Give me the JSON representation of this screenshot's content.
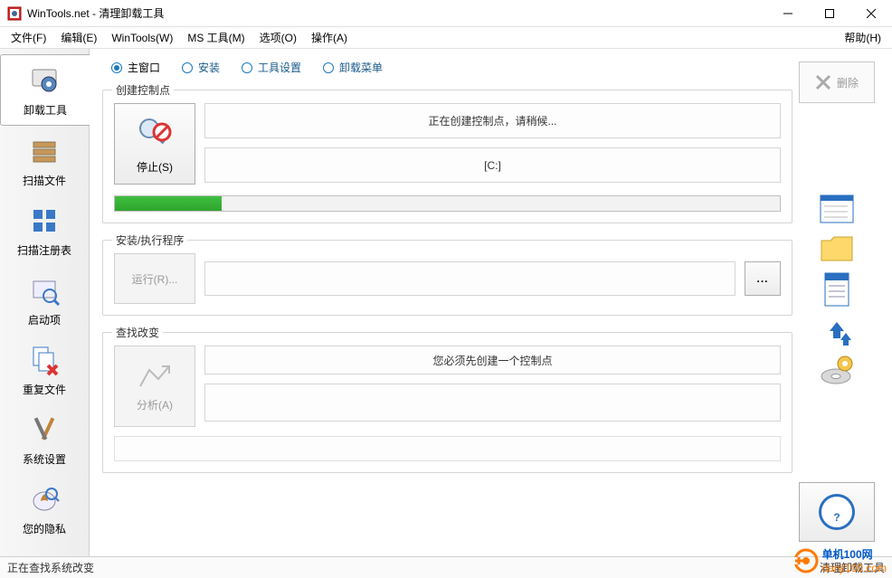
{
  "window": {
    "title": "WinTools.net - 清理卸载工具"
  },
  "menu": {
    "file": "文件(F)",
    "edit": "编辑(E)",
    "wintools": "WinTools(W)",
    "ms_tools": "MS 工具(M)",
    "options": "选项(O)",
    "operate": "操作(A)",
    "help": "帮助(H)"
  },
  "sidebar": {
    "uninstall": "卸载工具",
    "scan_files": "扫描文件",
    "scan_registry": "扫描注册表",
    "startup": "启动项",
    "dup_files": "重复文件",
    "sys_settings": "系统设置",
    "privacy": "您的隐私"
  },
  "tabs": {
    "main_window": "主窗口",
    "install": "安装",
    "tool_settings": "工具设置",
    "uninstall_menu": "卸载菜单"
  },
  "groups": {
    "create": {
      "title": "创建控制点",
      "stop_btn": "停止(S)",
      "msg1": "正在创建控制点，请稍候...",
      "msg2": "[C:]"
    },
    "install": {
      "title": "安装/执行程序",
      "run_btn": "运行(R)..."
    },
    "find": {
      "title": "查找改变",
      "analyze_btn": "分析(A)",
      "msg": "您必须先创建一个控制点"
    }
  },
  "browse_btn": "...",
  "delete_btn": "删除",
  "status": {
    "left": "正在查找系统改变",
    "right": "清理卸载工具"
  },
  "watermark": {
    "brand": "单机100网",
    "url": "danji100.com"
  }
}
